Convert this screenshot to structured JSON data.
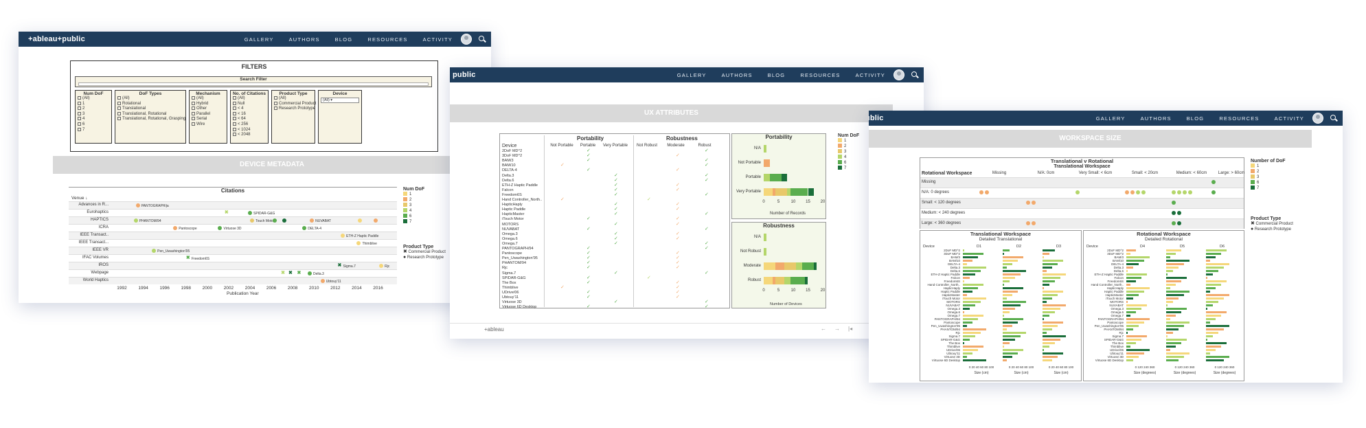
{
  "nav": {
    "logo": "+ableau+public",
    "logo_partial": "public",
    "items": [
      "GALLERY",
      "AUTHORS",
      "BLOG",
      "RESOURCES",
      "ACTIVITY"
    ]
  },
  "colors": {
    "dof_1": "#f5d77a",
    "dof_2": "#f2a96b",
    "dof_3": "#e8c86a",
    "dof_4": "#b4d66a",
    "dof_6": "#5aad4e",
    "dof_7": "#1a6e3a",
    "nav_bg": "#1f3d5c"
  },
  "screen1": {
    "filters_title": "FILTERS",
    "search_title": "Search Filter",
    "columns": [
      {
        "title": "Num DoF",
        "items": [
          "(All)",
          "1",
          "2",
          "3",
          "4",
          "6",
          "7"
        ]
      },
      {
        "title": "DoF Types",
        "items": [
          "(All)",
          "Rotational",
          "Translational",
          "Translational, Rotational",
          "Translational, Rotational, Grasping"
        ]
      },
      {
        "title": "Mechanism",
        "items": [
          "(All)",
          "Hybrid",
          "Other",
          "Parallel",
          "Serial",
          "Wire"
        ]
      },
      {
        "title": "No. of Citations",
        "items": [
          "(All)",
          "Null",
          "< 4",
          "< 16",
          "< 64",
          "< 256",
          "< 1024",
          "< 2048"
        ]
      },
      {
        "title": "Product Type",
        "items": [
          "(All)",
          "Commercial Product",
          "Research Prototype"
        ]
      },
      {
        "title": "Device",
        "items": [
          "(All)"
        ]
      }
    ],
    "band_title": "DEVICE METADATA",
    "citations_title": "Citations",
    "venue_header": "Venue ↓",
    "venues": [
      "Advances in R...",
      "Eurohaptics",
      "HAPTICS",
      "ICRA",
      "IEEE Transact..",
      "IEEE Transact...",
      "IEEE VR",
      "IFAC Volumes",
      "IROS",
      "Webpage",
      "World Haptics"
    ],
    "years": [
      "1992",
      "1994",
      "1996",
      "1998",
      "2000",
      "2002",
      "2004",
      "2006",
      "2008",
      "2010",
      "2012",
      "2014",
      "2016"
    ],
    "xlabel": "Publication Year",
    "points": [
      {
        "row": 0,
        "year": 1993.5,
        "label": "PANTOGRAPH/ja",
        "color": "#f2a96b",
        "shape": "dot"
      },
      {
        "row": 1,
        "year": 2001.8,
        "label": "",
        "color": "#b4d66a",
        "shape": "x"
      },
      {
        "row": 1,
        "year": 2004,
        "label": "SPIDAR-G&G",
        "color": "#5aad4e",
        "shape": "dot"
      },
      {
        "row": 2,
        "year": 1993.3,
        "label": "PHANTOM/94",
        "color": "#b4d66a",
        "shape": "dot"
      },
      {
        "row": 2,
        "year": 2004.2,
        "label": "Touch Motor",
        "color": "#e8c86a",
        "shape": "dot"
      },
      {
        "row": 2,
        "year": 2006.3,
        "label": "",
        "color": "#5aad4e",
        "shape": "dot"
      },
      {
        "row": 2,
        "year": 2007.2,
        "label": "",
        "color": "#1a6e3a",
        "shape": "dot"
      },
      {
        "row": 2,
        "year": 2009.8,
        "label": "NUVABAT",
        "color": "#f2a96b",
        "shape": "dot"
      },
      {
        "row": 2,
        "year": 2014.3,
        "label": "",
        "color": "#f5d77a",
        "shape": "dot"
      },
      {
        "row": 2,
        "year": 2015.8,
        "label": "",
        "color": "#f2a96b",
        "shape": "dot"
      },
      {
        "row": 3,
        "year": 1997,
        "label": "Pantoscope",
        "color": "#f2a96b",
        "shape": "dot"
      },
      {
        "row": 3,
        "year": 2001.2,
        "label": "Virtuose 3D",
        "color": "#5aad4e",
        "shape": "dot"
      },
      {
        "row": 3,
        "year": 2009.1,
        "label": "DELTA-4",
        "color": "#5aad4e",
        "shape": "dot"
      },
      {
        "row": 4,
        "year": 2012.7,
        "label": "ETH-Z Haptic Paddle",
        "color": "#f5d77a",
        "shape": "dot"
      },
      {
        "row": 5,
        "year": 2014.2,
        "label": "Thimblive",
        "color": "#f5d77a",
        "shape": "dot"
      },
      {
        "row": 6,
        "year": 1995,
        "label": "Pen_Uwashington'95",
        "color": "#b4d66a",
        "shape": "dot"
      },
      {
        "row": 7,
        "year": 1998.2,
        "label": "Freedom6S",
        "color": "#5aad4e",
        "shape": "x"
      },
      {
        "row": 8,
        "year": 2012.4,
        "label": "Sigma.7",
        "color": "#1a6e3a",
        "shape": "x"
      },
      {
        "row": 8,
        "year": 2016.3,
        "label": "Rjc",
        "color": "#f5d77a",
        "shape": "dot"
      },
      {
        "row": 9,
        "year": 2007.1,
        "label": "",
        "color": "#b4d66a",
        "shape": "x"
      },
      {
        "row": 9,
        "year": 2007.8,
        "label": "",
        "color": "#1a6e3a",
        "shape": "x"
      },
      {
        "row": 9,
        "year": 2008.6,
        "label": "",
        "color": "#5aad4e",
        "shape": "x"
      },
      {
        "row": 9,
        "year": 2009.6,
        "label": "Delta.3",
        "color": "#5aad4e",
        "shape": "dot"
      },
      {
        "row": 10,
        "year": 2010.8,
        "label": "Ubtouy'11",
        "color": "#f2a96b",
        "shape": "dot"
      }
    ],
    "legend_numdof_title": "Num DoF",
    "legend_numdof": [
      "1",
      "2",
      "3",
      "4",
      "6",
      "7"
    ],
    "legend_product_title": "Product Type",
    "legend_product": [
      "Commercial Product",
      "Research Prototype"
    ]
  },
  "screen2": {
    "band_title": "UX ATTRIBUTES",
    "device_header": "Device",
    "portability_title": "Portability",
    "robustness_title": "Robustness",
    "port_cols": [
      "Not Portable",
      "Portable",
      "Very Portable"
    ],
    "rob_cols": [
      "Not Robust",
      "Moderate",
      "Robust"
    ],
    "devices": [
      "2DoF MD^2",
      "3DoF MD^2",
      "BAM/3",
      "BAM/10",
      "DELTA-4",
      "Delta.3",
      "Delta.6",
      "ETH-Z Haptic Paddle",
      "Falcon",
      "Freedom6S",
      "Hand Controller_North..",
      "HapticHaply",
      "Haptic Paddle",
      "HapticMaster",
      "iTouch Motor",
      "MOTORS",
      "NUVABAT",
      "Omega.3",
      "Omega.6",
      "Omega.7",
      "PANTOGRAPH/94",
      "Pantoscope",
      "Pen_Uwashington'95",
      "PHANTOM/94",
      "Rjc",
      "Sigma.7",
      "SPIDAR-G&G",
      "The Box",
      "Thimblive",
      "UDrive/06",
      "Ubtouy'11",
      "Virtuose 3D",
      "Virtuose 6D Desktop"
    ],
    "port_marks": [
      1,
      1,
      1,
      0,
      1,
      2,
      2,
      2,
      2,
      2,
      0,
      2,
      2,
      2,
      1,
      2,
      1,
      2,
      2,
      2,
      1,
      1,
      1,
      1,
      1,
      2,
      1,
      1,
      0,
      1,
      1,
      2,
      1
    ],
    "rob_marks": [
      2,
      1,
      2,
      2,
      1,
      2,
      2,
      1,
      1,
      2,
      0,
      1,
      1,
      2,
      1,
      1,
      2,
      1,
      1,
      2,
      2,
      1,
      1,
      1,
      1,
      2,
      0,
      1,
      1,
      1,
      1,
      2,
      2
    ],
    "port_chart_title": "Portability",
    "port_categories": [
      "N/A",
      "Not Portable",
      "Portable",
      "Very Portable"
    ],
    "port_axis": [
      "0",
      "5",
      "10",
      "15",
      "20"
    ],
    "port_xlabel": "Number of Records",
    "rob_chart_title": "Robustness",
    "rob_categories": [
      "N/A",
      "Not Robust",
      "Moderate",
      "Robust"
    ],
    "rob_axis": [
      "0",
      "5",
      "10",
      "15",
      "20"
    ],
    "rob_xlabel": "Number of Devices",
    "port_stacks": [
      [
        0,
        0,
        0,
        1,
        0,
        0
      ],
      [
        0,
        2,
        0,
        0,
        0,
        0
      ],
      [
        0,
        0,
        0,
        2,
        4,
        2
      ],
      [
        3,
        1,
        4,
        1,
        6,
        2
      ]
    ],
    "rob_stacks": [
      [
        0,
        0,
        0,
        1,
        0,
        0
      ],
      [
        0,
        0,
        0,
        1,
        0,
        0
      ],
      [
        4,
        3,
        4,
        2,
        4,
        1
      ],
      [
        3,
        1,
        3,
        2,
        5,
        1
      ]
    ],
    "legend_title": "Num DoF",
    "legend": [
      "1",
      "2",
      "3",
      "4",
      "6",
      "7"
    ],
    "footer_brand": "+ableau"
  },
  "screen3": {
    "band_title": "WORKSPACE SIZE",
    "top_title": "Translational v Rotational",
    "top_sub": "Translational Workspace",
    "rot_header": "Rotational Workspace",
    "cols": [
      "Missing",
      "N/A: 0cm",
      "Very Small: < 6cm",
      "Small: < 20cm",
      "Medium: < 60cm",
      "Large: > 60cm"
    ],
    "rows": [
      "Missing",
      "N/A: 0 degrees",
      "Small: < 120 degrees",
      "Medium: < 240 degrees",
      "Large: < 360 degrees"
    ],
    "trans_title": "Translational Workspace",
    "trans_sub": "Detailed Translational",
    "trans_cols": [
      "D1",
      "D2",
      "D3"
    ],
    "rot_title": "Rotational Workspace",
    "rot_sub": "Detailed Rotational",
    "rot_cols": [
      "D4",
      "D5",
      "D6"
    ],
    "device_header": "Device",
    "trans_axis": "0 20 40 60 80 100",
    "rot_axis": "0 120 240 360",
    "trans_xlabel": "Size (cm)",
    "rot_xlabel": "Size (degrees)",
    "legend_title": "Number of DoF",
    "legend": [
      "1",
      "2",
      "3",
      "6",
      "7"
    ],
    "legend_product_title": "Product Type",
    "legend_product": [
      "Commercial Product",
      "Research Prototype"
    ]
  }
}
